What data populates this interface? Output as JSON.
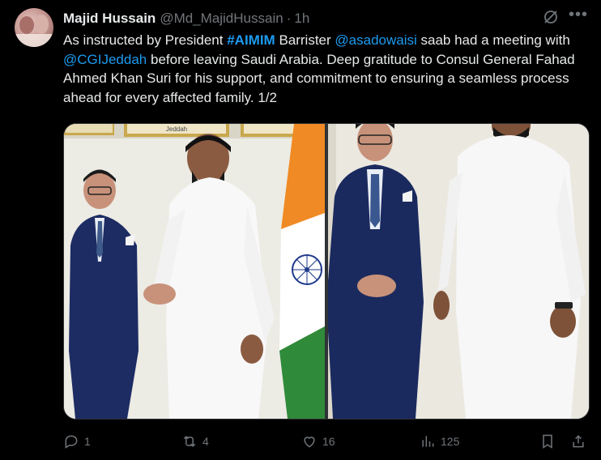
{
  "tweet": {
    "author_name": "Majid Hussain",
    "handle": "@Md_MajidHussain",
    "separator": "·",
    "time": "1h",
    "text": {
      "p1": "As instructed by President ",
      "hashtag": "#AIMIM",
      "p2": " Barrister ",
      "mention1": "@asadowaisi",
      "p3": " saab had a meeting with ",
      "mention2": "@CGIJeddah",
      "p4": " before leaving Saudi Arabia. Deep gratitude to Consul General Fahad Ahmed Khan Suri for his support, and commitment to ensuring a seamless process ahead for every affected family. 1/2"
    },
    "photo_plaque_text": "Jeddah"
  },
  "actions": {
    "reply_count": "1",
    "retweet_count": "4",
    "like_count": "16",
    "views_count": "125"
  },
  "icons": [
    "grok-icon",
    "more-icon",
    "reply-icon",
    "retweet-icon",
    "like-icon",
    "views-icon",
    "bookmark-icon",
    "share-icon"
  ],
  "colors": {
    "background": "#000000",
    "text": "#e7e9ea",
    "secondary": "#71767b",
    "link": "#1d9bf0"
  }
}
